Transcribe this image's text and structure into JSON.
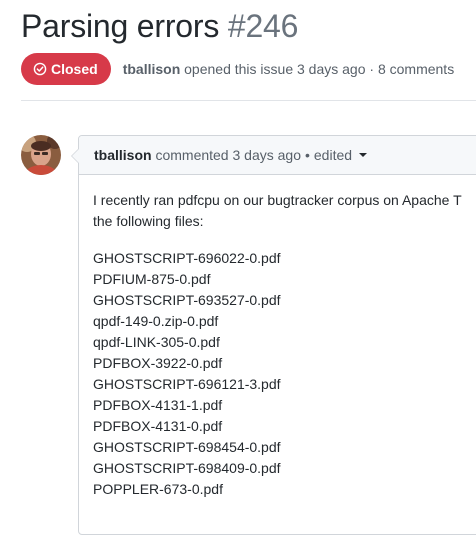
{
  "issue": {
    "title": "Parsing errors",
    "number": "#246",
    "state": "Closed",
    "author": "tballison",
    "opened_text": "opened this issue 3 days ago",
    "separator": "·",
    "comments_count": "8 comments"
  },
  "comment": {
    "author": "tballison",
    "action": "commented 3 days ago",
    "separator": "•",
    "edited": "edited",
    "body_line1": "I recently ran pdfcpu on our bugtracker corpus on Apache T",
    "body_line2": "the following files:",
    "files": [
      "GHOSTSCRIPT-696022-0.pdf",
      "PDFIUM-875-0.pdf",
      "GHOSTSCRIPT-693527-0.pdf",
      "qpdf-149-0.zip-0.pdf",
      "qpdf-LINK-305-0.pdf",
      "PDFBOX-3922-0.pdf",
      "GHOSTSCRIPT-696121-3.pdf",
      "PDFBOX-4131-1.pdf",
      "PDFBOX-4131-0.pdf",
      "GHOSTSCRIPT-698454-0.pdf",
      "GHOSTSCRIPT-698409-0.pdf",
      "POPPLER-673-0.pdf"
    ]
  },
  "colors": {
    "closed_badge": "#d73a49",
    "muted_text": "#586069",
    "border": "#d1d5da",
    "header_bg": "#f6f8fa"
  },
  "icons": {
    "state": "issue-closed-icon",
    "dropdown": "triangle-down-icon"
  }
}
